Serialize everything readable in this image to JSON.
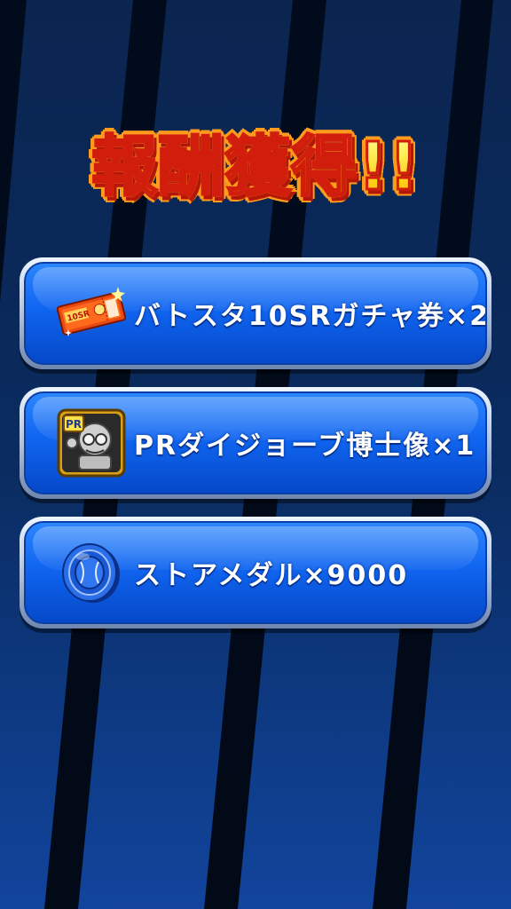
{
  "screen": {
    "title": "報酬獲得!!"
  },
  "rewards": [
    {
      "label": "バトスタ10SRガチャ券×2",
      "icon": "gacha-ticket-icon"
    },
    {
      "label": "PRダイジョーブ博士像×1",
      "icon": "pr-doctor-statue-icon"
    },
    {
      "label": "ストアメダル×9000",
      "icon": "store-medal-icon"
    }
  ],
  "colors": {
    "title_fill": "#ffd21a",
    "title_outline": "#d11e0c",
    "panel_blue": "#1065f0",
    "background": "#0a2a5c"
  }
}
